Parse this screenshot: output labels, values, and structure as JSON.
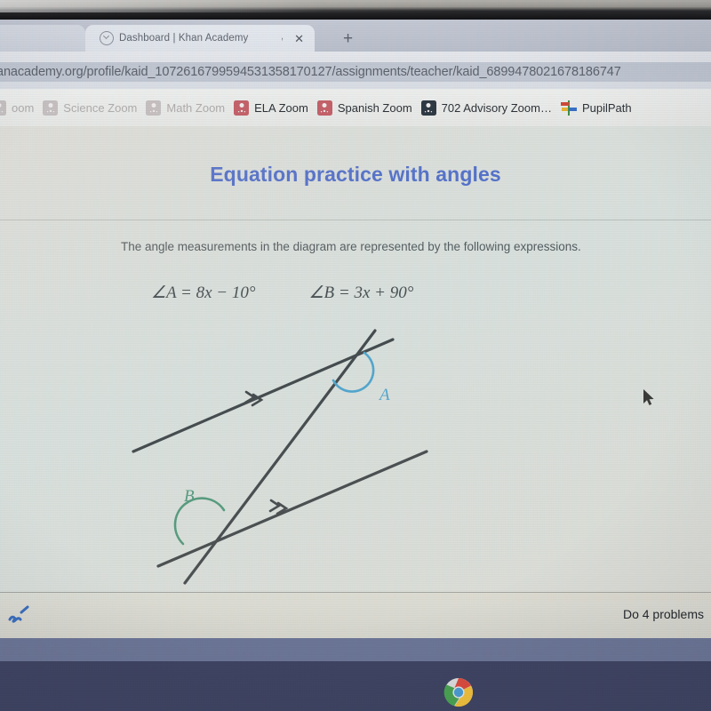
{
  "browser": {
    "tab": {
      "title": "Dashboard | Khan Academy",
      "favicon_name": "khan-academy-favicon",
      "separator": ",",
      "close_label": "✕"
    },
    "new_tab_label": "+",
    "url": "anacademy.org/profile/kaid_1072616799594531358170127/assignments/teacher/kaid_6899478021678186747",
    "bookmarks": [
      {
        "label": "oom",
        "icon": "zoom-icon",
        "style": "faded"
      },
      {
        "label": "Science Zoom",
        "icon": "zoom-icon",
        "style": "faded"
      },
      {
        "label": "Math Zoom",
        "icon": "zoom-icon",
        "style": "faded"
      },
      {
        "label": "ELA Zoom",
        "icon": "zoom-icon",
        "style": "zoomred"
      },
      {
        "label": "Spanish Zoom",
        "icon": "zoom-icon",
        "style": "zoomred"
      },
      {
        "label": "702 Advisory Zoom…",
        "icon": "zoom-icon",
        "style": "zoomdark"
      },
      {
        "label": "PupilPath",
        "icon": "pupilpath-icon",
        "style": "pupilpath"
      }
    ]
  },
  "exercise": {
    "title": "Equation practice with angles",
    "prompt": "The angle measurements in the diagram are represented by the following expressions.",
    "expressions": [
      {
        "id": "angle-a",
        "text": "∠A = 8x − 10°"
      },
      {
        "id": "angle-b",
        "text": "∠B = 3x + 90°"
      }
    ],
    "diagram": {
      "angle_a_label": "A",
      "angle_b_label": "B",
      "angle_a_color": "#3a9ccd",
      "angle_b_color": "#3f8f6e",
      "line_color": "#2b2f33",
      "parallel_mark": "double-arrow",
      "description": "Two parallel lines cut by a transversal"
    },
    "footer": {
      "scribble_icon": "pencil-scribble-icon",
      "do_problems": "Do 4 problems"
    }
  },
  "os": {
    "taskbar_icon": "chrome-icon"
  },
  "colors": {
    "title_blue": "#3558c9",
    "angle_a": "#3a9ccd",
    "angle_b": "#3f8f6e",
    "shelf": "#3f4463"
  }
}
